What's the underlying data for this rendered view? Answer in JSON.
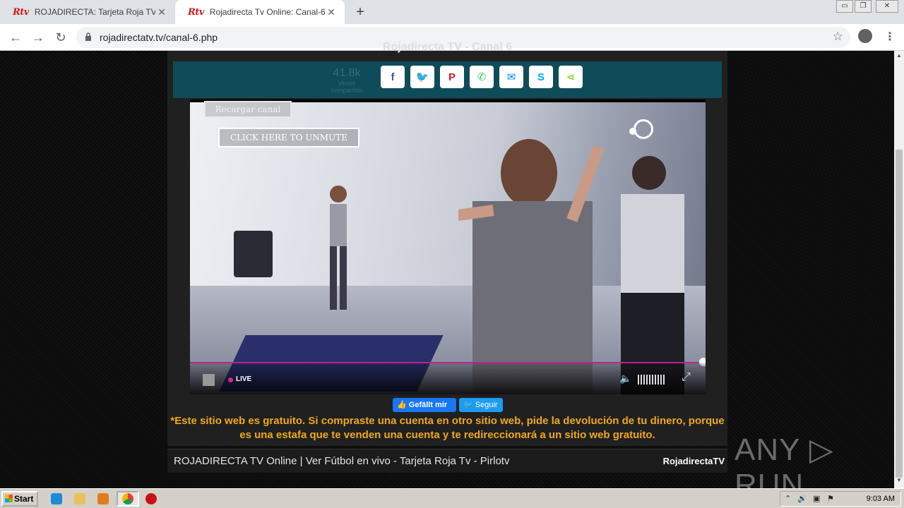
{
  "browser": {
    "tabs": [
      {
        "favicon": "Rtv",
        "title": "ROJADIRECTA: Tarjeta Roja TV - Pir",
        "close": "✕"
      },
      {
        "favicon": "Rtv",
        "title": "Rojadirecta Tv Online: Canal-6",
        "close": "✕"
      }
    ],
    "new_tab": "+",
    "url": "rojadirectatv.tv/canal-6.php",
    "window_controls": [
      "▭",
      "❐",
      "✕"
    ]
  },
  "page": {
    "top_title": "Rojadirecta TV - Canal 6",
    "share": {
      "count": "41.8k",
      "count_label": "Veces compartido",
      "buttons": [
        {
          "name": "facebook",
          "glyph": "f",
          "color": "#3b5998"
        },
        {
          "name": "twitter",
          "glyph": "🐦",
          "color": "#1da1f2"
        },
        {
          "name": "pinterest",
          "glyph": "P",
          "color": "#cb2027"
        },
        {
          "name": "whatsapp",
          "glyph": "✆",
          "color": "#25d366"
        },
        {
          "name": "messenger",
          "glyph": "✉",
          "color": "#0084ff"
        },
        {
          "name": "skype",
          "glyph": "S",
          "color": "#00aff0"
        },
        {
          "name": "sharethis",
          "glyph": "⋖",
          "color": "#95d03a"
        }
      ]
    },
    "player": {
      "reload_label": "Recargar canal",
      "unmute_label": "CLICK HERE TO UNMUTE",
      "live_label": "LIVE",
      "accent": "#c0208c"
    },
    "social": {
      "fb_label": "Gefällt mir",
      "tw_label": "Seguir"
    },
    "notice": "*Este sitio web es gratuito. Si compraste una cuenta en otro sitio web, pide la devolución de tu dinero, porque es una estafa que te venden una cuenta y te redireccionará a un sitio web gratuito.",
    "footer": {
      "left": "ROJADIRECTA TV Online | Ver Fútbol en vivo - Tarjeta Roja Tv - Pirlotv",
      "right": "RojadirectaTV"
    },
    "watermark": "ANY ▷ RUN"
  },
  "taskbar": {
    "start_label": "Start",
    "clock": "9:03 AM"
  }
}
